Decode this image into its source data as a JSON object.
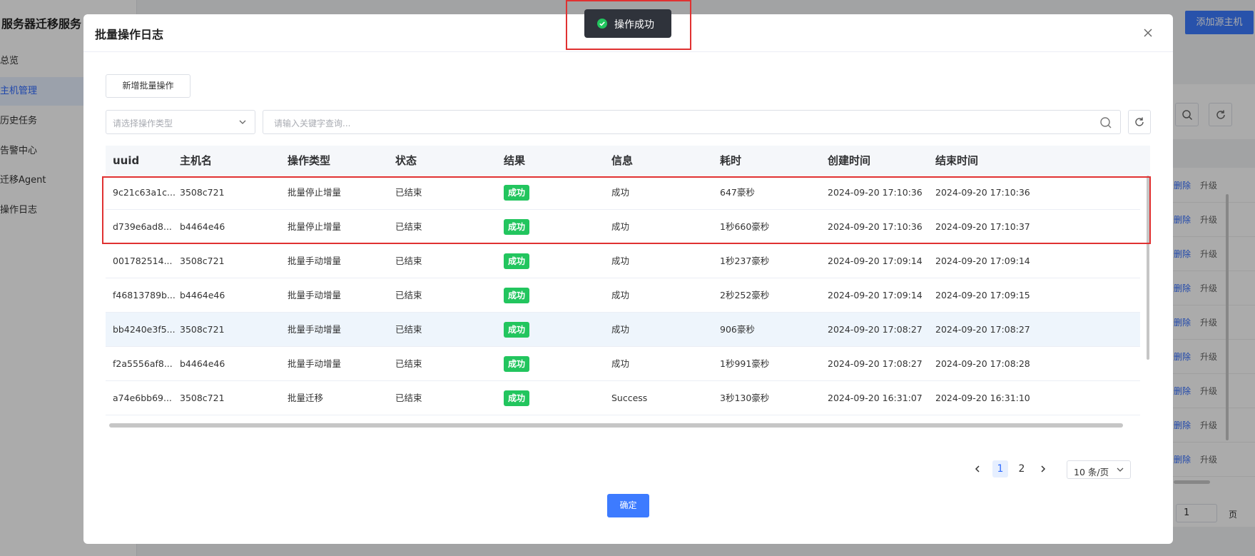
{
  "background": {
    "sidebar_title": "服务器迁移服务",
    "sidebar_items": [
      {
        "label": "总览",
        "active": false
      },
      {
        "label": "主机管理",
        "active": true
      },
      {
        "label": "历史任务",
        "active": false
      },
      {
        "label": "告警中心",
        "active": false
      },
      {
        "label": "迁移Agent",
        "active": false
      },
      {
        "label": "操作日志",
        "active": false
      }
    ],
    "add_host_label": "添加源主机",
    "row_actions": {
      "delete": "删除",
      "upgrade": "升级"
    },
    "page_input_value": "1",
    "page_suffix": "页"
  },
  "toast": {
    "text": "操作成功",
    "icon": "check-circle-icon"
  },
  "modal": {
    "title": "批量操作日志",
    "new_button": "新增批量操作",
    "select_placeholder": "请选择操作类型",
    "search_placeholder": "请输入关键字查询...",
    "ok_button": "确定",
    "columns": [
      "uuid",
      "主机名",
      "操作类型",
      "状态",
      "结果",
      "信息",
      "耗时",
      "创建时间",
      "结束时间"
    ],
    "rows": [
      [
        "9c21c63a1c...",
        "3508c721",
        "批量停止增量",
        "已结束",
        "成功",
        "成功",
        "647豪秒",
        "2024-09-20 17:10:36",
        "2024-09-20 17:10:36"
      ],
      [
        "d739e6ad8...",
        "b4464e46",
        "批量停止增量",
        "已结束",
        "成功",
        "成功",
        "1秒660豪秒",
        "2024-09-20 17:10:36",
        "2024-09-20 17:10:37"
      ],
      [
        "001782514...",
        "3508c721",
        "批量手动增量",
        "已结束",
        "成功",
        "成功",
        "1秒237豪秒",
        "2024-09-20 17:09:14",
        "2024-09-20 17:09:14"
      ],
      [
        "f46813789b...",
        "b4464e46",
        "批量手动增量",
        "已结束",
        "成功",
        "成功",
        "2秒252豪秒",
        "2024-09-20 17:09:14",
        "2024-09-20 17:09:15"
      ],
      [
        "bb4240e3f5...",
        "3508c721",
        "批量手动增量",
        "已结束",
        "成功",
        "成功",
        "906豪秒",
        "2024-09-20 17:08:27",
        "2024-09-20 17:08:27"
      ],
      [
        "f2a5556af8...",
        "b4464e46",
        "批量手动增量",
        "已结束",
        "成功",
        "成功",
        "1秒991豪秒",
        "2024-09-20 17:08:27",
        "2024-09-20 17:08:28"
      ],
      [
        "a74e6bb69...",
        "3508c721",
        "批量迁移",
        "已结束",
        "成功",
        "Success",
        "3秒130豪秒",
        "2024-09-20 16:31:07",
        "2024-09-20 16:31:10"
      ]
    ],
    "pagination": {
      "pages": [
        "1",
        "2"
      ],
      "current": "1",
      "page_size": "10 条/页"
    }
  },
  "colors": {
    "primary": "#3d7bff",
    "success_tag": "#22c55e",
    "annotation_red": "#e03131",
    "toast_bg": "#2f333b"
  }
}
